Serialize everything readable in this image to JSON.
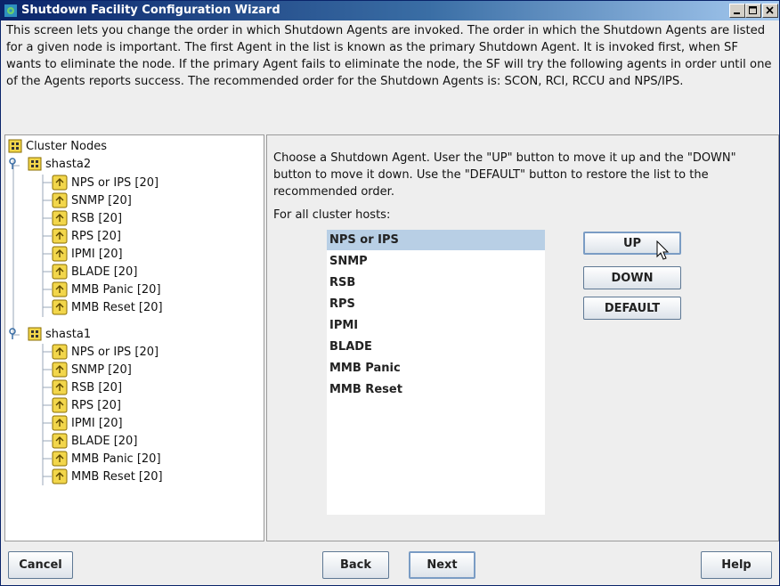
{
  "window": {
    "title": "Shutdown Facility Configuration Wizard",
    "description": "This screen lets you change the order in which Shutdown Agents are invoked. The order in which the Shutdown Agents are listed for a given node is important. The first Agent in the list is known as the primary Shutdown Agent. It is invoked first, when SF wants to eliminate the node. If the primary Agent fails to eliminate the node, the SF will try the following agents in order until one of the Agents reports success. The recommended order for the Shutdown Agents is: SCON, RCI, RCCU and NPS/IPS."
  },
  "tree": {
    "root_label": "Cluster Nodes",
    "nodes": [
      {
        "label": "shasta2",
        "agents": [
          "NPS or IPS [20]",
          "SNMP [20]",
          "RSB [20]",
          "RPS [20]",
          "IPMI [20]",
          "BLADE [20]",
          "MMB Panic [20]",
          "MMB Reset [20]"
        ]
      },
      {
        "label": "shasta1",
        "agents": [
          "NPS or IPS [20]",
          "SNMP [20]",
          "RSB [20]",
          "RPS [20]",
          "IPMI [20]",
          "BLADE [20]",
          "MMB Panic [20]",
          "MMB Reset [20]"
        ]
      }
    ]
  },
  "right": {
    "instructions": "Choose a Shutdown Agent. User the \"UP\" button to move it up and the \"DOWN\" button to move it down. Use the \"DEFAULT\" button to restore the list to the recommended order.",
    "for_all": "For all cluster hosts:",
    "agents": [
      "NPS or IPS",
      "SNMP",
      "RSB",
      "RPS",
      "IPMI",
      "BLADE",
      "MMB Panic",
      "MMB Reset"
    ],
    "selected_index": 0,
    "buttons": {
      "up": "UP",
      "down": "DOWN",
      "default": "DEFAULT"
    }
  },
  "footer": {
    "cancel": "Cancel",
    "back": "Back",
    "next": "Next",
    "help": "Help"
  },
  "colors": {
    "titlebar_start": "#0a246a",
    "titlebar_end": "#a6caf0",
    "selection": "#b8cfe5",
    "folder_yellow": "#f2d64b"
  }
}
